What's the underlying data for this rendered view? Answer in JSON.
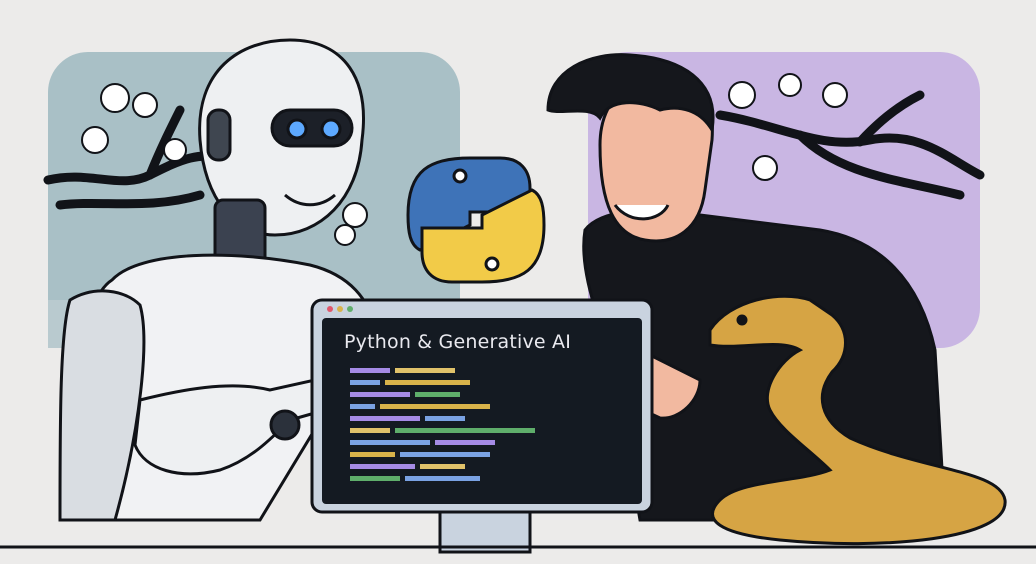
{
  "illustration": {
    "monitor_title": "Python & Generative AI",
    "colors": {
      "background": "#ecebea",
      "left_panel": "#a9c0c6",
      "right_panel": "#c9b6e3",
      "python_blue": "#3e73b8",
      "python_yellow": "#f2cb48",
      "screen": "#141a22",
      "snake": "#d6a444",
      "shirt": "#15171c",
      "skin": "#f2b9a0"
    },
    "icons": [
      "python-logo-icon",
      "pen-icon"
    ]
  }
}
